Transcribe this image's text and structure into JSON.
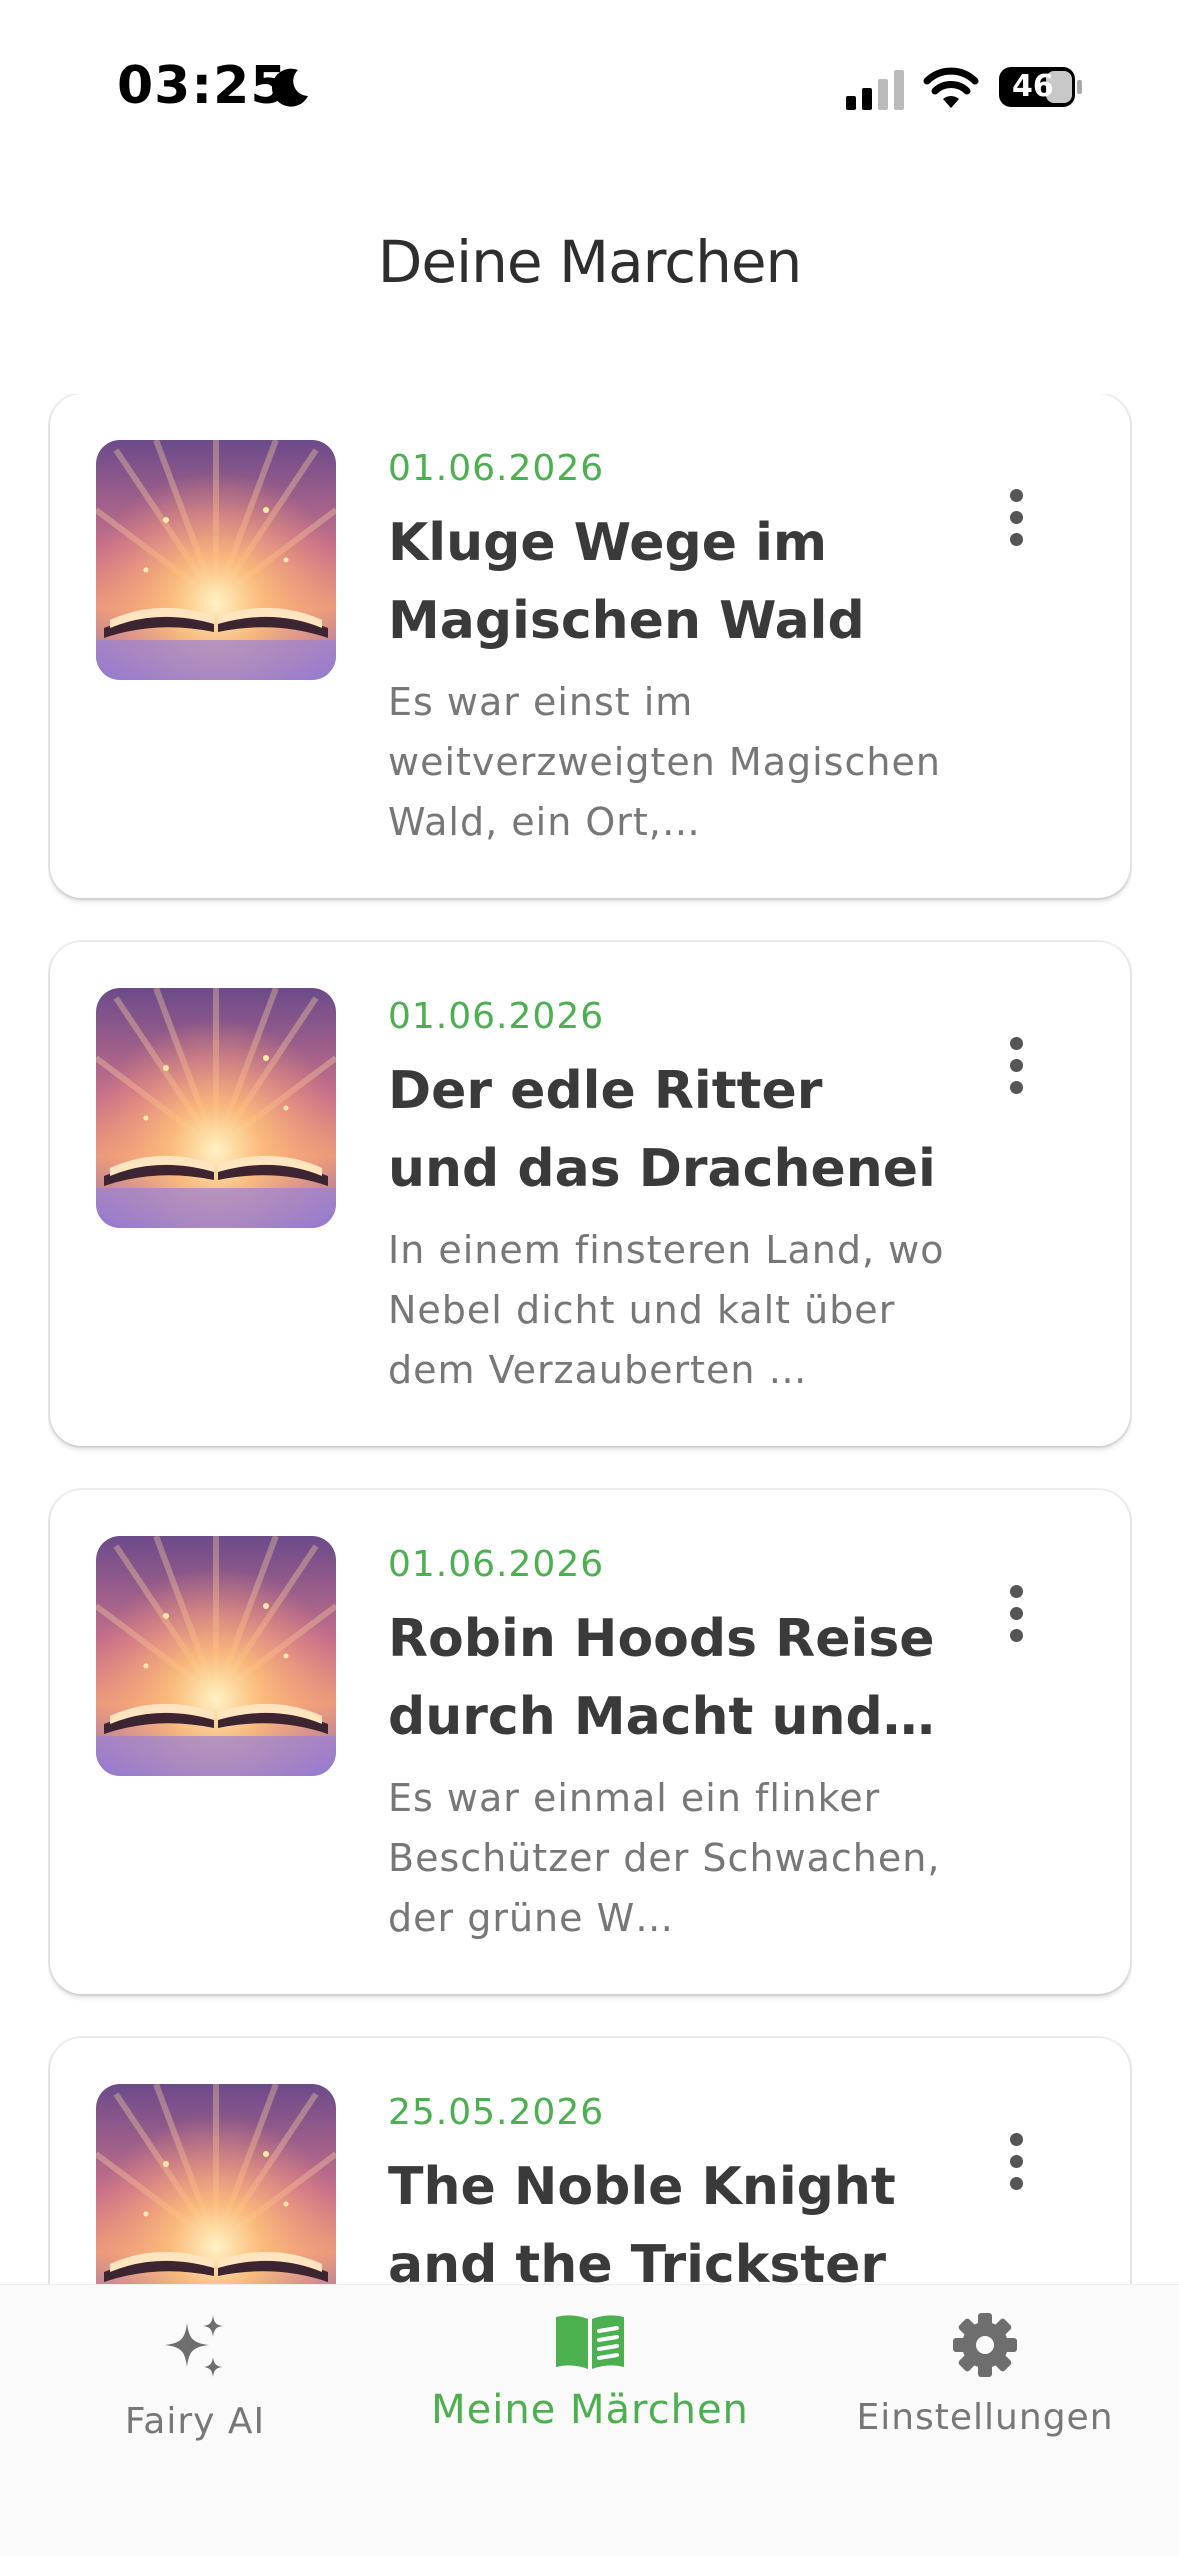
{
  "status_bar": {
    "time": "03:25",
    "battery": "46",
    "icons": [
      "moon-icon",
      "signal-icon",
      "wifi-icon",
      "battery-icon"
    ]
  },
  "header": {
    "title": "Deine Marchen"
  },
  "colors": {
    "accent": "#4caf50",
    "text": "#3a3a3a",
    "muted": "#777777"
  },
  "stories": [
    {
      "date": "01.06.2026",
      "title": "Kluge Wege im Magischen Wald",
      "excerpt": "Es war einst im weitverzweigten Magischen Wald, ein Ort,…",
      "image": "magic-book-image"
    },
    {
      "date": "01.06.2026",
      "title": "Der edle Ritter und das Drachenei",
      "excerpt": "In einem finsteren Land, wo Nebel dicht und kalt über dem Verzauberten …",
      "image": "magic-book-image"
    },
    {
      "date": "01.06.2026",
      "title": "Robin Hoods Reise durch Macht und …",
      "excerpt": "Es war einmal ein flinker Beschützer der Schwachen, der grüne W…",
      "image": "magic-book-image"
    },
    {
      "date": "25.05.2026",
      "title": "The Noble Knight and the Trickster",
      "excerpt": "",
      "image": "magic-book-image"
    }
  ],
  "bottom_nav": [
    {
      "label": "Fairy AI",
      "icon": "sparkles-icon",
      "active": false
    },
    {
      "label": "Meine Märchen",
      "icon": "book-icon",
      "active": true
    },
    {
      "label": "Einstellungen",
      "icon": "gear-icon",
      "active": false
    }
  ]
}
